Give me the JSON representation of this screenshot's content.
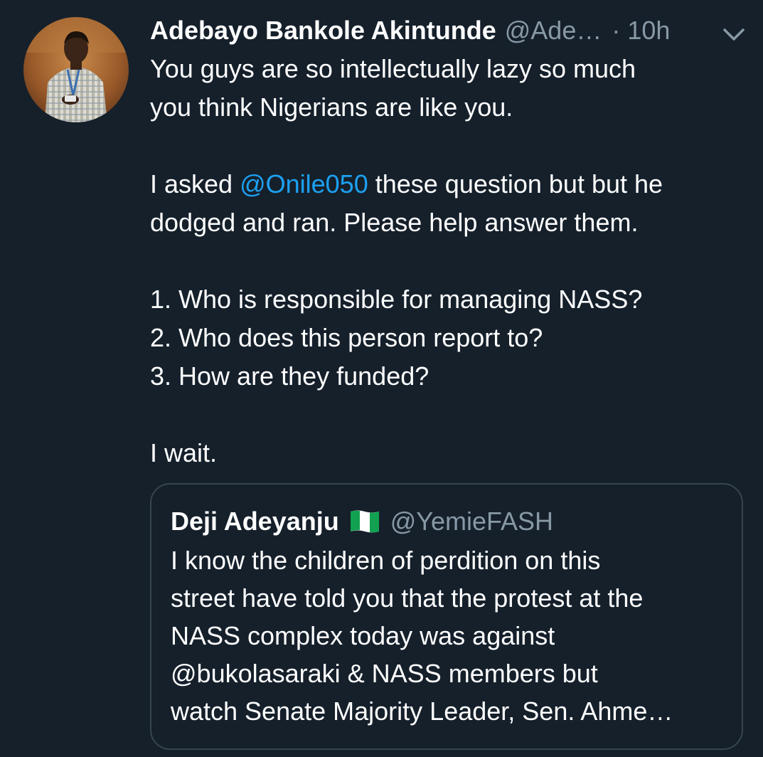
{
  "tweet": {
    "author_name": "Adebayo Bankole Akintunde",
    "author_handle": "@Ade…",
    "separator": "·",
    "timestamp": "10h",
    "body": {
      "line1": "You guys are so intellectually lazy so much",
      "line2": "you think Nigerians are like you.",
      "line3_prefix": "I asked ",
      "line3_mention": "@Onile050",
      "line3_suffix": " these question but but he",
      "line4": "dodged and ran. Please help answer them.",
      "q1": "1. Who is responsible for managing NASS?",
      "q2": "2. Who does this person report to?",
      "q3": "3. How are they funded?",
      "closing": "I wait."
    }
  },
  "quoted_tweet": {
    "author_name": "Deji Adeyanju",
    "flag_icon": "nigeria-flag-icon",
    "author_handle": "@YemieFASH",
    "lines": [
      "I know the children of perdition on this",
      "street have told you that the protest at the",
      "NASS complex today was against",
      "@bukolasaraki & NASS members but",
      "watch Senate Majority Leader, Sen. Ahme…"
    ]
  },
  "colors": {
    "background": "#15202b",
    "primary_text": "#ffffff",
    "secondary_text": "#8899a6",
    "link": "#1da1f2",
    "border": "#38444d"
  }
}
